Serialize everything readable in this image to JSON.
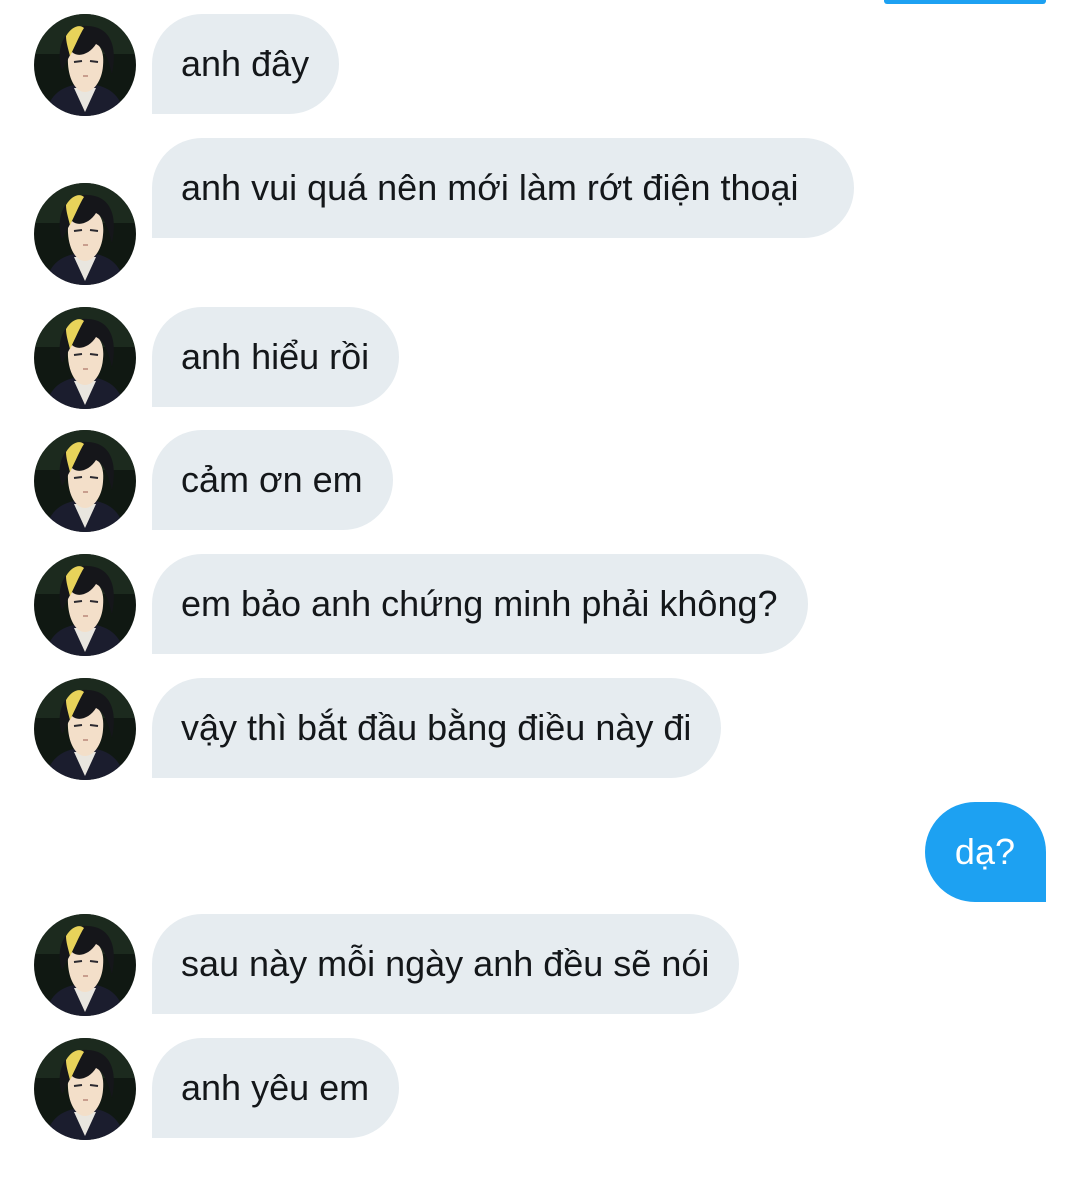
{
  "theme": {
    "received_bubble_color": "#e6ecf0",
    "received_text_color": "#14171a",
    "sent_bubble_color": "#1da1f2",
    "sent_text_color": "#ffffff"
  },
  "conversation": {
    "messages": [
      {
        "from": "them",
        "text": "anh đây",
        "avatar": "contact-avatar-icon"
      },
      {
        "from": "them",
        "text": "anh vui quá nên mới làm rớt điện thoại",
        "avatar": "contact-avatar-icon"
      },
      {
        "from": "them",
        "text": "anh hiểu rồi",
        "avatar": "contact-avatar-icon"
      },
      {
        "from": "them",
        "text": "cảm ơn em",
        "avatar": "contact-avatar-icon"
      },
      {
        "from": "them",
        "text": "em bảo anh chứng minh phải không?",
        "avatar": "contact-avatar-icon"
      },
      {
        "from": "them",
        "text": "vậy thì bắt đầu bằng điều này đi",
        "avatar": "contact-avatar-icon"
      },
      {
        "from": "me",
        "text": "dạ?"
      },
      {
        "from": "them",
        "text": "sau này mỗi ngày anh đều sẽ nói",
        "avatar": "contact-avatar-icon"
      },
      {
        "from": "them",
        "text": "anh yêu em",
        "avatar": "contact-avatar-icon"
      }
    ]
  }
}
